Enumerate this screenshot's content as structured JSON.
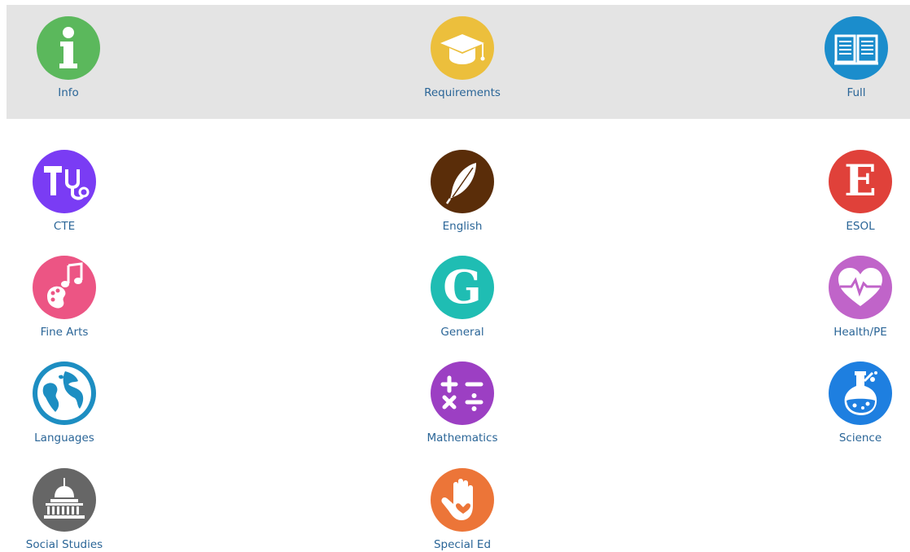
{
  "nav": {
    "info": {
      "label": "Info",
      "icon": "info-icon",
      "color": "#5bb85c"
    },
    "requirements": {
      "label": "Requirements",
      "icon": "graduation-cap-icon",
      "color": "#ecbf3c"
    },
    "full": {
      "label": "Full",
      "icon": "open-book-icon",
      "color": "#1b8dcc"
    }
  },
  "subjects": {
    "cte": {
      "label": "CTE",
      "icon": "hammer-stethoscope-icon",
      "color": "#7a3cf4"
    },
    "english": {
      "label": "English",
      "icon": "feather-quill-icon",
      "color": "#5a2d09"
    },
    "esol": {
      "label": "ESOL",
      "icon": "letter-e-icon",
      "color": "#e0413a",
      "glyph": "E"
    },
    "fine_arts": {
      "label": "Fine Arts",
      "icon": "music-palette-icon",
      "color": "#ec5584"
    },
    "general": {
      "label": "General",
      "icon": "letter-g-icon",
      "color": "#1fbdb3",
      "glyph": "G"
    },
    "health_pe": {
      "label": "Health/PE",
      "icon": "heartbeat-icon",
      "color": "#c064c9"
    },
    "languages": {
      "label": "Languages",
      "icon": "globe-icon",
      "color": "#1d8ec2"
    },
    "mathematics": {
      "label": "Mathematics",
      "icon": "math-operators-icon",
      "color": "#9c3fc3"
    },
    "science": {
      "label": "Science",
      "icon": "flask-icon",
      "color": "#1e7fe0"
    },
    "social_studies": {
      "label": "Social Studies",
      "icon": "capitol-building-icon",
      "color": "#666666"
    },
    "special_ed": {
      "label": "Special Ed",
      "icon": "hand-heart-icon",
      "color": "#ec7538"
    }
  }
}
